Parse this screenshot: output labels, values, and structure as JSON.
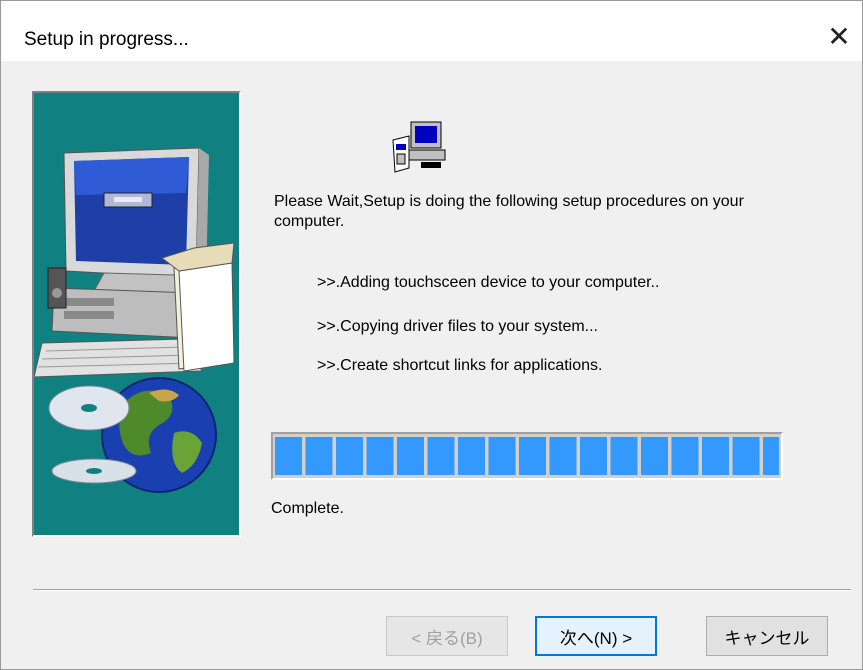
{
  "window": {
    "title": "Setup in progress...",
    "close_label": "✕"
  },
  "content": {
    "intro": "Please Wait,Setup is doing the following setup procedures on your computer.",
    "steps": [
      ">>.Adding touchsceen device to your computer..",
      ">>.Copying driver files to your system...",
      ">>.Create shortcut links for applications."
    ],
    "progress": {
      "value": 1.0,
      "color": "#3399ff"
    },
    "status": "Complete."
  },
  "buttons": {
    "back": {
      "label": "< 戻る(B)",
      "enabled": false
    },
    "next": {
      "label": "次へ(N) >",
      "enabled": true
    },
    "cancel": {
      "label": "キャンセル",
      "enabled": true
    }
  },
  "colors": {
    "side_panel_bg": "#108080",
    "accent": "#0078d7"
  },
  "icons": [
    "setup-wizard-icon",
    "computer-illustration",
    "globe-cd-illustration",
    "close-icon"
  ]
}
